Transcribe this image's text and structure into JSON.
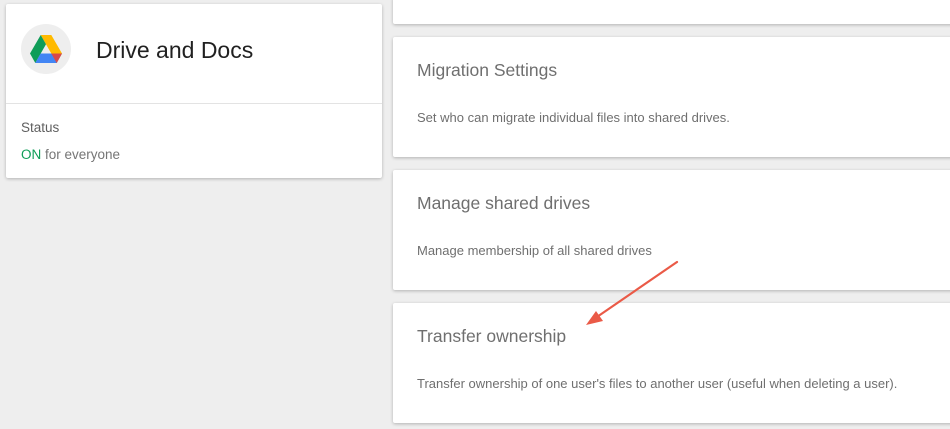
{
  "app": {
    "icon": "google-drive-icon",
    "title": "Drive and Docs",
    "status_label": "Status",
    "status_value": "ON",
    "status_suffix": " for everyone"
  },
  "settings": [
    {
      "title": "Migration Settings",
      "description": "Set who can migrate individual files into shared drives."
    },
    {
      "title": "Manage shared drives",
      "description": "Manage membership of all shared drives"
    },
    {
      "title": "Transfer ownership",
      "description": "Transfer ownership of one user's files to another user (useful when deleting a user)."
    }
  ],
  "annotation": {
    "type": "arrow",
    "color": "#ea5a47",
    "points_to": "transfer-ownership-title"
  },
  "colors": {
    "status_on": "#0f9d58",
    "background": "#eeeeee"
  }
}
